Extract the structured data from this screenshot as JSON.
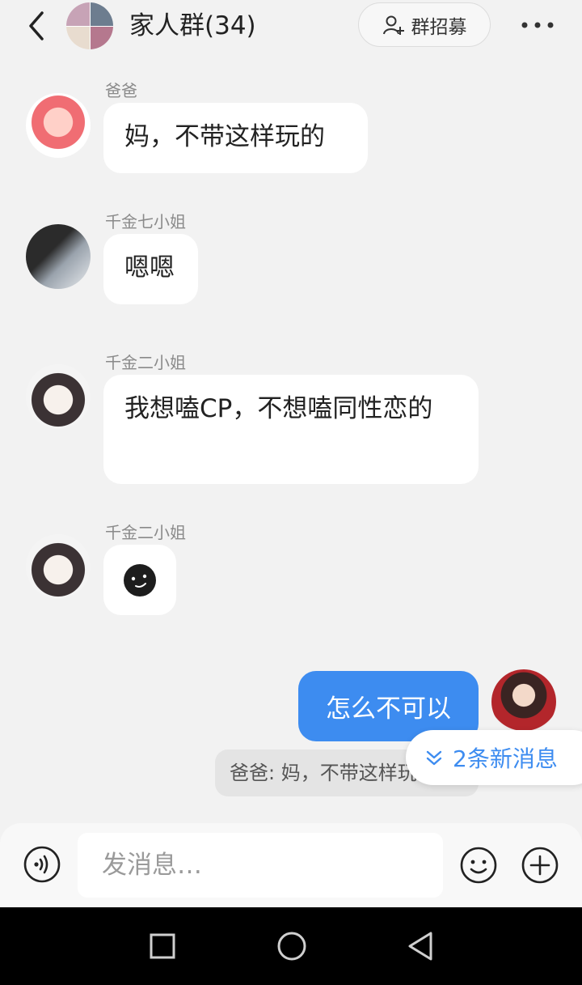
{
  "header": {
    "title": "家人群(34)",
    "recruit_label": "群招募",
    "icons": [
      "back-icon",
      "group-avatar",
      "add-person-icon",
      "more-icon"
    ]
  },
  "messages": [
    {
      "sender": "爸爸",
      "text": "妈，不带这样玩的"
    },
    {
      "sender": "千金七小姐",
      "text": "嗯嗯"
    },
    {
      "sender": "千金二小姐",
      "text": "我想嗑CP，不想嗑同性恋的"
    },
    {
      "sender": "千金二小姐",
      "text": "",
      "emoji": "smirk-emoji"
    }
  ],
  "my_message": {
    "text": "怎么不可以"
  },
  "preview": {
    "text": "爸爸: 妈，不带这样玩的"
  },
  "new_messages": {
    "label": "2条新消息"
  },
  "input": {
    "placeholder": "发消息…"
  },
  "colors": {
    "accent": "#3d8cf0",
    "background": "#f2f2f2",
    "bubble": "#ffffff"
  }
}
